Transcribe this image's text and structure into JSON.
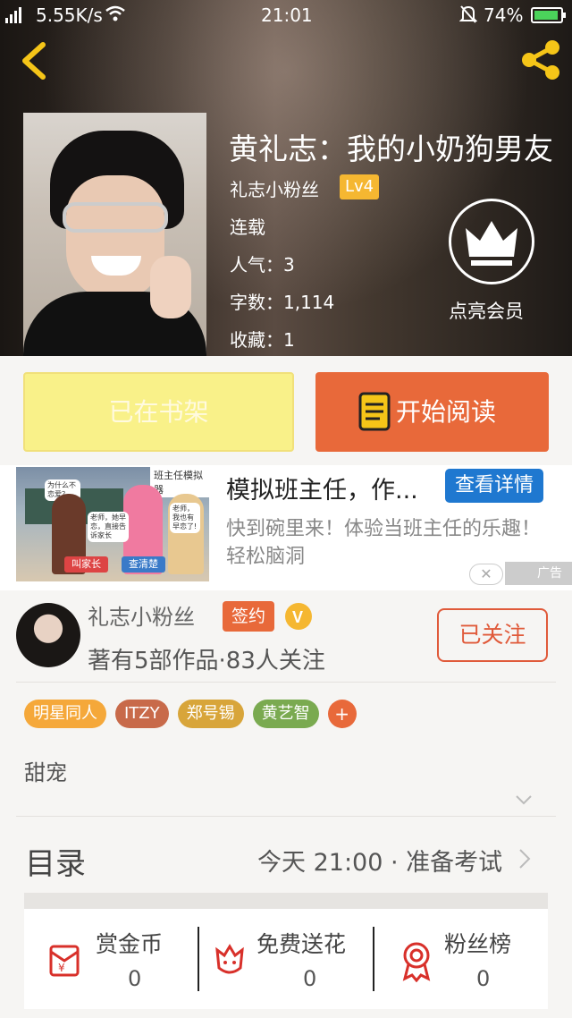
{
  "status_bar": {
    "network": "5.55K/s",
    "time": "21:01",
    "battery": "74%"
  },
  "book": {
    "title": "黄礼志：我的小奶狗男友",
    "author": "礼志小粉丝",
    "level": "Lv4",
    "status": "连载",
    "popularity": "人气：3",
    "word_count": "字数：1,114",
    "favorites": "收藏：1",
    "vip_label": "点亮会员"
  },
  "actions": {
    "shelf_label": "已在书架",
    "read_label": "开始阅读"
  },
  "ad": {
    "title": "模拟班主任，作...",
    "button": "查看详情",
    "desc": "快到碗里来！体验当班主任的乐趣！轻松脑洞",
    "mark": "广告",
    "image_sign": "班主任模拟器",
    "image_btn1": "叫家长",
    "image_btn2": "查清楚",
    "bubble1": "为什么不恋爱？",
    "bubble2": "老师，她早恋，直接告诉家长",
    "bubble3": "老师，我也有早恋了!"
  },
  "author_profile": {
    "name": "礼志小粉丝",
    "sign_badge": "签约",
    "works": "著有5部作品·83人关注",
    "follow_label": "已关注"
  },
  "tags": [
    {
      "label": "明星同人",
      "color": "#f5a83a"
    },
    {
      "label": "ITZY",
      "color": "#c86a4a"
    },
    {
      "label": "郑号锡",
      "color": "#d8a53a"
    },
    {
      "label": "黄艺智",
      "color": "#7aaa50"
    },
    {
      "label": "+",
      "color": "#e8693a"
    }
  ],
  "genre": "甜宠",
  "toc": {
    "label": "目录",
    "latest": "今天 21:00 · 准备考试"
  },
  "stats": [
    {
      "label": "赏金币",
      "value": "0",
      "icon": "red-envelope-icon"
    },
    {
      "label": "免费送花",
      "value": "0",
      "icon": "flower-icon"
    },
    {
      "label": "粉丝榜",
      "value": "0",
      "icon": "medal-icon"
    }
  ],
  "colors": {
    "accent": "#e8693a",
    "shelf": "#f9f189",
    "ad_button": "#1f78d0"
  }
}
